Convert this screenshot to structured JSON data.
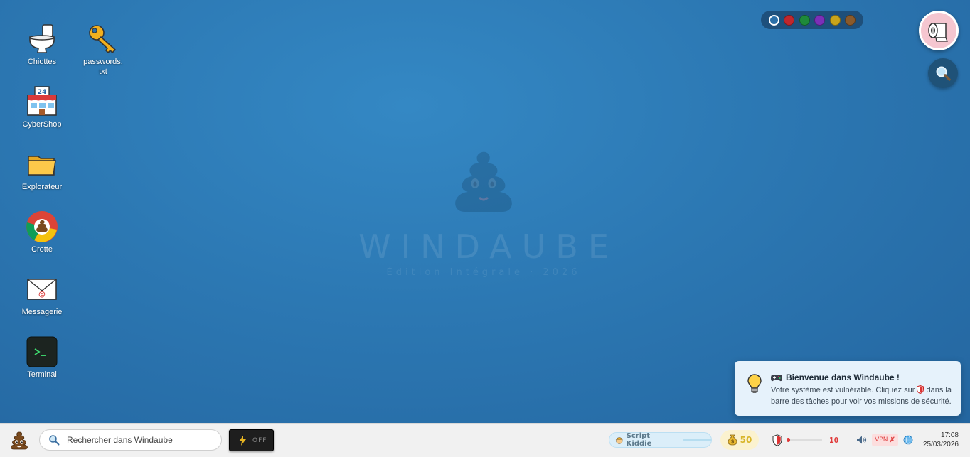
{
  "watermark": {
    "title": "WINDAUBE",
    "subtitle": "Édition Intégrale · 2026"
  },
  "desktop_icons": [
    {
      "id": "chiottes",
      "label": "Chiottes",
      "icon": "toilet-icon"
    },
    {
      "id": "passwords",
      "label": "passwords.\ntxt",
      "icon": "key-icon"
    },
    {
      "id": "cybershop",
      "label": "CyberShop",
      "icon": "store-24-icon"
    },
    {
      "id": "explorateur",
      "label": "Explorateur",
      "icon": "folder-icon"
    },
    {
      "id": "crotte",
      "label": "Crotte",
      "icon": "browser-poop-icon"
    },
    {
      "id": "messagerie",
      "label": "Messagerie",
      "icon": "mail-icon"
    },
    {
      "id": "terminal",
      "label": "Terminal",
      "icon": "terminal-icon"
    }
  ],
  "color_picker": {
    "colors": [
      "#2a6fa8",
      "#c0272d",
      "#1e8a3a",
      "#7b2fb8",
      "#c9a41a",
      "#8a5a2b"
    ],
    "selected_index": 0
  },
  "notification": {
    "icon": "lightbulb-icon",
    "title_icon": "gamepad-icon",
    "title": "Bienvenue dans Windaube !",
    "body_before": "Votre système est vulnérable. Cliquez sur",
    "body_icon": "shield-icon",
    "body_after": "dans la barre des tâches pour voir vos missions de sécurité."
  },
  "taskbar": {
    "search_placeholder": "Rechercher dans Windaube",
    "power_label": "OFF",
    "rank_label": "Script Kiddie",
    "rank_progress": 0.0,
    "coins_value": "50",
    "security_value": "10",
    "security_progress": 0.1,
    "vpn_label": "VPN",
    "vpn_status": "✗",
    "time": "17:08",
    "date": "25/03/2026"
  },
  "colors": {
    "desktop_bg": "#2c78b3",
    "accent_red": "#e03b3b",
    "coin_gold": "#d8b528"
  }
}
